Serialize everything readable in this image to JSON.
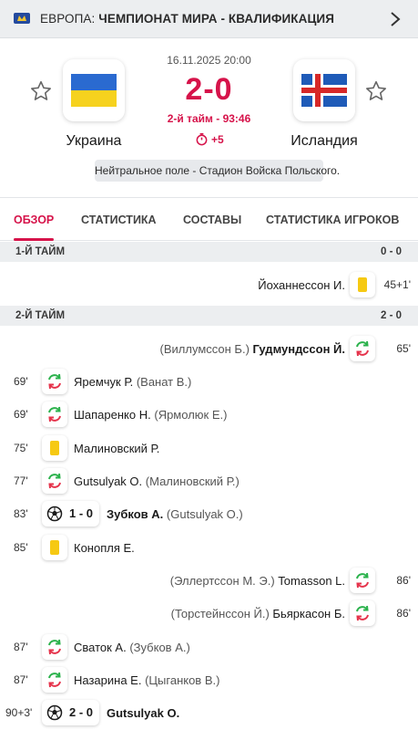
{
  "competition": {
    "country": "ЕВРОПА:",
    "name": "ЧЕМПИОНАТ МИРА - КВАЛИФИКАЦИЯ"
  },
  "match": {
    "datetime": "16.11.2025 20:00",
    "score": "2-0",
    "period": "2-й тайм - 93:46",
    "added_time": "+5",
    "venue": "Нейтральное поле - Стадион Войска Польского.",
    "home_team": "Украина",
    "away_team": "Исландия"
  },
  "tabs": [
    "ОБЗОР",
    "СТАТИСТИКА",
    "СОСТАВЫ",
    "СТАТИСТИКА ИГРОКОВ"
  ],
  "halves": [
    {
      "label": "1-Й ТАЙМ",
      "score": "0 - 0"
    },
    {
      "label": "2-Й ТАЙМ",
      "score": "2 - 0"
    }
  ],
  "events": [
    {
      "minute": "45+1'",
      "player": "Йоханнессон И.",
      "sub_player": ""
    },
    {
      "minute": "65'",
      "player": "Гудмундссон Й.",
      "sub_player": "(Виллумссон Б.)"
    },
    {
      "minute": "69'",
      "player": "Яремчук Р.",
      "sub_player": "(Ванат В.)"
    },
    {
      "minute": "69'",
      "player": "Шапаренко Н.",
      "sub_player": "(Ярмолюк Е.)"
    },
    {
      "minute": "75'",
      "player": "Малиновский Р.",
      "sub_player": ""
    },
    {
      "minute": "77'",
      "player": "Gutsulyak O.",
      "sub_player": "(Малиновский Р.)"
    },
    {
      "minute": "83'",
      "goal_score": "1 - 0",
      "player": "Зубков А.",
      "sub_player": "(Gutsulyak O.)"
    },
    {
      "minute": "85'",
      "player": "Конопля Е.",
      "sub_player": ""
    },
    {
      "minute": "86'",
      "player": "Tomasson L.",
      "sub_player": "(Эллертссон М. Э.)"
    },
    {
      "minute": "86'",
      "player": "Бьяркасон Б.",
      "sub_player": "(Торстейнссон Й.)"
    },
    {
      "minute": "87'",
      "player": "Сваток А.",
      "sub_player": "(Зубков А.)"
    },
    {
      "minute": "87'",
      "player": "Назарина Е.",
      "sub_player": "(Цыганков В.)"
    },
    {
      "minute": "90+3'",
      "goal_score": "2 - 0",
      "player": "Gutsulyak O.",
      "sub_player": ""
    }
  ],
  "colors": {
    "accent": "#d6134a",
    "yellow_card": "#f6c913",
    "sub_green": "#2bb24c",
    "sub_red": "#e5334b"
  }
}
